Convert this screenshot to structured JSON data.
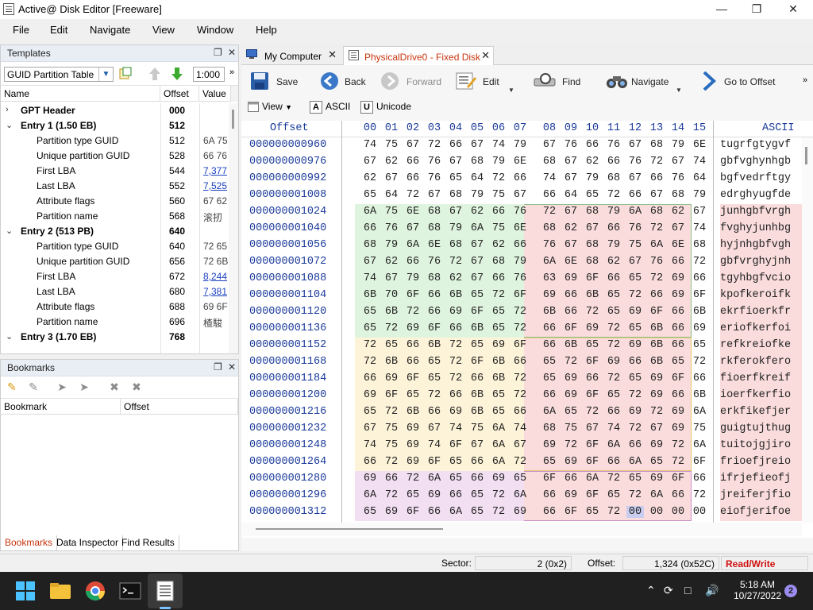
{
  "window": {
    "title": "Active@ Disk Editor [Freeware]"
  },
  "menu": [
    "File",
    "Edit",
    "Navigate",
    "View",
    "Window",
    "Help"
  ],
  "templates": {
    "title": "Templates",
    "selected": "GUID Partition Table",
    "zoom": "1:000",
    "columns": [
      "Name",
      "Offset",
      "Value"
    ],
    "rows": [
      {
        "name": "GPT Header",
        "offset": "000",
        "value": "",
        "level": 0,
        "bold": true,
        "toggle": "›",
        "link": false
      },
      {
        "name": "Entry 1 (1.50 EB)",
        "offset": "512",
        "value": "",
        "level": 0,
        "bold": true,
        "toggle": "⌄",
        "link": false
      },
      {
        "name": "Partition type GUID",
        "offset": "512",
        "value": "6A 75",
        "level": 1,
        "bold": false,
        "toggle": "",
        "link": false
      },
      {
        "name": "Unique partition GUID",
        "offset": "528",
        "value": "66 76",
        "level": 1,
        "bold": false,
        "toggle": "",
        "link": false
      },
      {
        "name": "First LBA",
        "offset": "544",
        "value": "7,377",
        "level": 1,
        "bold": false,
        "toggle": "",
        "link": true
      },
      {
        "name": "Last LBA",
        "offset": "552",
        "value": "7,525",
        "level": 1,
        "bold": false,
        "toggle": "",
        "link": true
      },
      {
        "name": "Attribute flags",
        "offset": "560",
        "value": "67 62",
        "level": 1,
        "bold": false,
        "toggle": "",
        "link": false
      },
      {
        "name": "Partition name",
        "offset": "568",
        "value": "滚扨",
        "level": 1,
        "bold": false,
        "toggle": "",
        "link": false
      },
      {
        "name": "Entry 2 (513 PB)",
        "offset": "640",
        "value": "",
        "level": 0,
        "bold": true,
        "toggle": "⌄",
        "link": false
      },
      {
        "name": "Partition type GUID",
        "offset": "640",
        "value": "72 65",
        "level": 1,
        "bold": false,
        "toggle": "",
        "link": false
      },
      {
        "name": "Unique partition GUID",
        "offset": "656",
        "value": "72 6B",
        "level": 1,
        "bold": false,
        "toggle": "",
        "link": false
      },
      {
        "name": "First LBA",
        "offset": "672",
        "value": "8,244",
        "level": 1,
        "bold": false,
        "toggle": "",
        "link": true
      },
      {
        "name": "Last LBA",
        "offset": "680",
        "value": "7,381",
        "level": 1,
        "bold": false,
        "toggle": "",
        "link": true
      },
      {
        "name": "Attribute flags",
        "offset": "688",
        "value": "69 6F",
        "level": 1,
        "bold": false,
        "toggle": "",
        "link": false
      },
      {
        "name": "Partition name",
        "offset": "696",
        "value": "楂駿",
        "level": 1,
        "bold": false,
        "toggle": "",
        "link": false
      },
      {
        "name": "Entry 3 (1.70 EB)",
        "offset": "768",
        "value": "",
        "level": 0,
        "bold": true,
        "toggle": "⌄",
        "link": false
      }
    ]
  },
  "bookmarks": {
    "title": "Bookmarks",
    "columns": [
      "Bookmark",
      "Offset"
    ]
  },
  "bottom_tabs": [
    "Bookmarks",
    "Data Inspector",
    "Find Results"
  ],
  "tabs": [
    {
      "label": "My Computer",
      "active": false
    },
    {
      "label": "PhysicalDrive0 - Fixed Disk",
      "active": true
    }
  ],
  "toolbar": {
    "save": "Save",
    "back": "Back",
    "forward": "Forward",
    "edit": "Edit",
    "find": "Find",
    "navigate": "Navigate",
    "goto": "Go to Offset"
  },
  "toolbar2": {
    "view": "View",
    "ascii": "ASCII",
    "unicode": "Unicode"
  },
  "hex": {
    "offset_header": "Offset",
    "ascii_header": "ASCII",
    "columns": [
      "00",
      "01",
      "02",
      "03",
      "04",
      "05",
      "06",
      "07",
      "08",
      "09",
      "10",
      "11",
      "12",
      "13",
      "14",
      "15"
    ],
    "selected_cell": {
      "row": 22,
      "col": 12
    },
    "rows": [
      {
        "offset": "000000000960",
        "bytes": "74 75 67 72 66 67 74 79 67 76 66 76 67 68 79 6E",
        "ascii": "tugrfgtygvf"
      },
      {
        "offset": "000000000976",
        "bytes": "67 62 66 76 67 68 79 6E 68 67 62 66 76 72 67 74",
        "ascii": "gbfvghynhgb"
      },
      {
        "offset": "000000000992",
        "bytes": "62 67 66 76 65 64 72 66 74 67 79 68 67 66 76 64",
        "ascii": "bgfvedrftgy"
      },
      {
        "offset": "000000001008",
        "bytes": "65 64 72 67 68 79 75 67 66 64 65 72 66 67 68 79",
        "ascii": "edrghyugfde"
      },
      {
        "offset": "000000001024",
        "bytes": "6A 75 6E 68 67 62 66 76 72 67 68 79 6A 68 62 67",
        "ascii": "junhgbfvrgh"
      },
      {
        "offset": "000000001040",
        "bytes": "66 76 67 68 79 6A 75 6E 68 62 67 66 76 72 67 74",
        "ascii": "fvghyjunhbg"
      },
      {
        "offset": "000000001056",
        "bytes": "68 79 6A 6E 68 67 62 66 76 67 68 79 75 6A 6E 68",
        "ascii": "hyjnhgbfvgh"
      },
      {
        "offset": "000000001072",
        "bytes": "67 62 66 76 72 67 68 79 6A 6E 68 62 67 76 66 72",
        "ascii": "gbfvrghyjnh"
      },
      {
        "offset": "000000001088",
        "bytes": "74 67 79 68 62 67 66 76 63 69 6F 66 65 72 69 66",
        "ascii": "tgyhbgfvcio"
      },
      {
        "offset": "000000001104",
        "bytes": "6B 70 6F 66 6B 65 72 6F 69 66 6B 65 72 66 69 6F",
        "ascii": "kpofkeroifk"
      },
      {
        "offset": "000000001120",
        "bytes": "65 6B 72 66 69 6F 65 72 6B 66 72 65 69 6F 66 6B",
        "ascii": "ekrfioerkfr"
      },
      {
        "offset": "000000001136",
        "bytes": "65 72 69 6F 66 6B 65 72 66 6F 69 72 65 6B 66 69",
        "ascii": "eriofkerfoi"
      },
      {
        "offset": "000000001152",
        "bytes": "72 65 66 6B 72 65 69 6F 66 6B 65 72 69 6B 66 65",
        "ascii": "refkreiofke"
      },
      {
        "offset": "000000001168",
        "bytes": "72 6B 66 65 72 6F 6B 66 65 72 6F 69 66 6B 65 72",
        "ascii": "rkferokfero"
      },
      {
        "offset": "000000001184",
        "bytes": "66 69 6F 65 72 66 6B 72 65 69 66 72 65 69 6F 66",
        "ascii": "fioerfkreif"
      },
      {
        "offset": "000000001200",
        "bytes": "69 6F 65 72 66 6B 65 72 66 69 6F 65 72 69 66 6B",
        "ascii": "ioerfkerfio"
      },
      {
        "offset": "000000001216",
        "bytes": "65 72 6B 66 69 6B 65 66 6A 65 72 66 69 72 69 6A",
        "ascii": "erkfikefjer"
      },
      {
        "offset": "000000001232",
        "bytes": "67 75 69 67 74 75 6A 74 68 75 67 74 72 67 69 75",
        "ascii": "guigtujthug"
      },
      {
        "offset": "000000001248",
        "bytes": "74 75 69 74 6F 67 6A 67 69 72 6F 6A 66 69 72 6A",
        "ascii": "tuitojgjiro"
      },
      {
        "offset": "000000001264",
        "bytes": "66 72 69 6F 65 66 6A 72 65 69 6F 66 6A 65 72 6F",
        "ascii": "frioefjreio"
      },
      {
        "offset": "000000001280",
        "bytes": "69 66 72 6A 65 66 69 65 6F 66 6A 72 65 69 6F 66",
        "ascii": "ifrjefieofj"
      },
      {
        "offset": "000000001296",
        "bytes": "6A 72 65 69 66 65 72 6A 66 69 6F 65 72 6A 66 72",
        "ascii": "jreiferjfio"
      },
      {
        "offset": "000000001312",
        "bytes": "65 69 6F 66 6A 65 72 69 66 6F 65 72 00 00 00 00",
        "ascii": "eiofjerifoe"
      }
    ]
  },
  "status": {
    "sector_label": "Sector:",
    "sector_value": "2 (0x2)",
    "offset_label": "Offset:",
    "offset_value": "1,324 (0x52C)",
    "mode": "Read/Write"
  },
  "taskbar": {
    "time": "5:18 AM",
    "date": "10/27/2022",
    "notifications": "2"
  },
  "colors": {
    "region_pink": "#fadcdc",
    "region_green": "#dff4de",
    "region_yellow": "#fdf3d8",
    "region_purple": "#f2dff2",
    "active_tab": "#c8340d",
    "offset_text": "#1a3a9a",
    "read_write": "#d01010"
  }
}
